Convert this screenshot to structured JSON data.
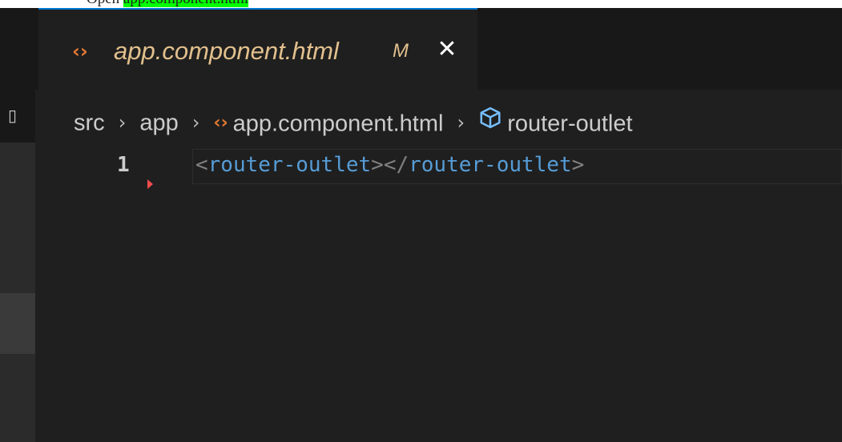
{
  "caption": {
    "prefix": "Open",
    "highlight": "app.component.html"
  },
  "tab": {
    "icon": "html-file-icon",
    "title": "app.component.html",
    "badge": "M",
    "close_glyph": "✕"
  },
  "breadcrumb": {
    "items": [
      "src",
      "app",
      "app.component.html",
      "router-outlet"
    ],
    "separator": "›"
  },
  "editor": {
    "lines": [
      {
        "number": "1",
        "tokens": {
          "open_lt": "<",
          "open_tag": "router-outlet",
          "open_gt": ">",
          "close_lt": "</",
          "close_tag": "router-outlet",
          "close_gt": ">"
        }
      }
    ]
  },
  "colors": {
    "background": "#1f1f1f",
    "tab_active_border": "#0078d4",
    "modified_text": "#e2c08d",
    "html_icon": "#e37933",
    "tag": "#569cd6",
    "punctuation": "#808080",
    "diff_marker": "#f14c4c",
    "symbol_icon": "#75beff"
  }
}
